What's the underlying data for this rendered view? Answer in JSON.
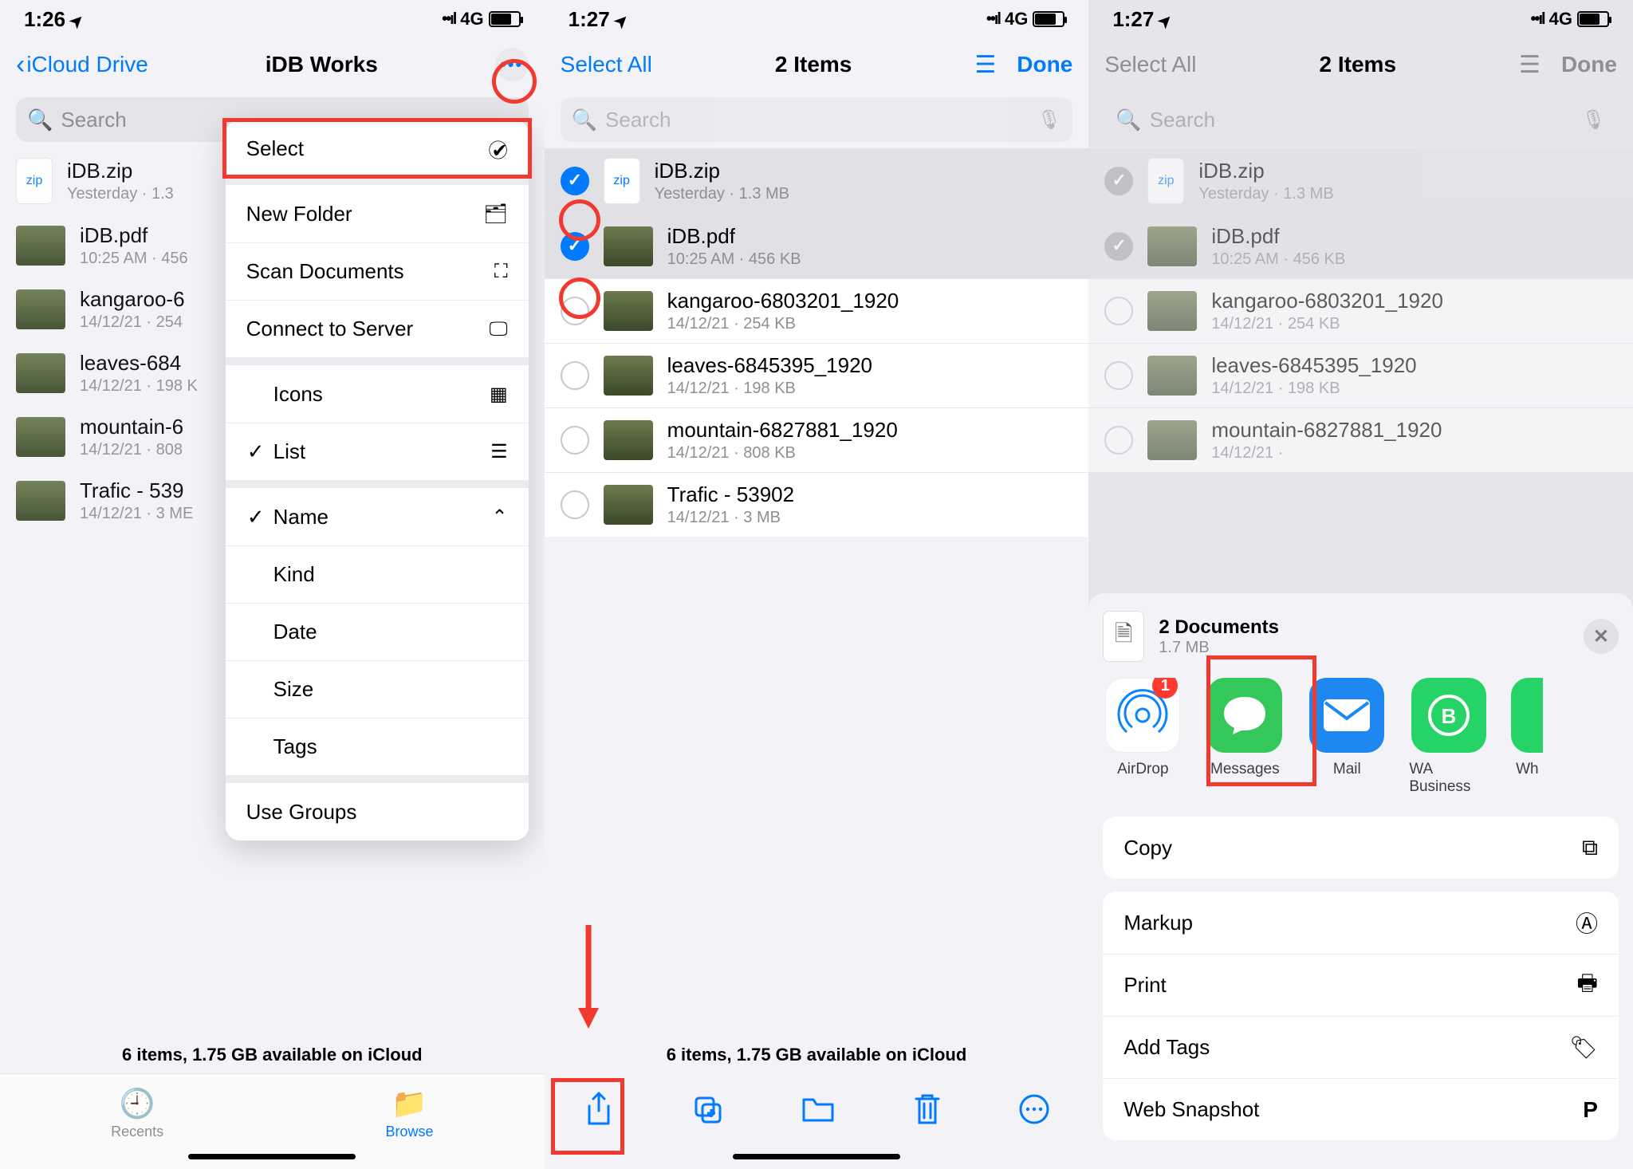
{
  "s1": {
    "time": "1:26",
    "net": "4G",
    "back": "iCloud Drive",
    "title": "iDB Works",
    "search": "Search",
    "menu": {
      "select": "Select",
      "newfolder": "New Folder",
      "scan": "Scan Documents",
      "connect": "Connect to Server",
      "icons": "Icons",
      "list": "List",
      "name": "Name",
      "kind": "Kind",
      "date": "Date",
      "size": "Size",
      "tags": "Tags",
      "groups": "Use Groups"
    },
    "files": [
      {
        "n": "iDB.zip",
        "s": "Yesterday · 1.3",
        "t": "zip"
      },
      {
        "n": "iDB.pdf",
        "s": "10:25 AM · 456",
        "t": "img"
      },
      {
        "n": "kangaroo-6",
        "s": "14/12/21 · 254",
        "t": "img"
      },
      {
        "n": "leaves-684",
        "s": "14/12/21 · 198 K",
        "t": "img"
      },
      {
        "n": "mountain-6",
        "s": "14/12/21 · 808",
        "t": "img"
      },
      {
        "n": "Trafic - 539",
        "s": "14/12/21 · 3 ME",
        "t": "img"
      }
    ],
    "bottom": "6 items, 1.75 GB available on iCloud",
    "tab_recents": "Recents",
    "tab_browse": "Browse"
  },
  "s2": {
    "time": "1:27",
    "net": "4G",
    "select_all": "Select All",
    "title": "2 Items",
    "done": "Done",
    "search": "Search",
    "files": [
      {
        "n": "iDB.zip",
        "s": "Yesterday · 1.3 MB",
        "t": "zip",
        "sel": true
      },
      {
        "n": "iDB.pdf",
        "s": "10:25 AM · 456 KB",
        "t": "img",
        "sel": true
      },
      {
        "n": "kangaroo-6803201_1920",
        "s": "14/12/21 · 254 KB",
        "t": "img",
        "sel": false
      },
      {
        "n": "leaves-6845395_1920",
        "s": "14/12/21 · 198 KB",
        "t": "img",
        "sel": false
      },
      {
        "n": "mountain-6827881_1920",
        "s": "14/12/21 · 808 KB",
        "t": "img",
        "sel": false
      },
      {
        "n": "Trafic - 53902",
        "s": "14/12/21 · 3 MB",
        "t": "img",
        "sel": false
      }
    ],
    "bottom": "6 items, 1.75 GB available on iCloud"
  },
  "s3": {
    "time": "1:27",
    "net": "4G",
    "select_all": "Select All",
    "title": "2 Items",
    "done": "Done",
    "search": "Search",
    "files": [
      {
        "n": "iDB.zip",
        "s": "Yesterday · 1.3 MB",
        "t": "zip",
        "sel": true
      },
      {
        "n": "iDB.pdf",
        "s": "10:25 AM · 456 KB",
        "t": "img",
        "sel": true
      },
      {
        "n": "kangaroo-6803201_1920",
        "s": "14/12/21 · 254 KB",
        "t": "img",
        "sel": false
      },
      {
        "n": "leaves-6845395_1920",
        "s": "14/12/21 · 198 KB",
        "t": "img",
        "sel": false
      },
      {
        "n": "mountain-6827881_1920",
        "s": "14/12/21 ·",
        "t": "img",
        "sel": false
      }
    ],
    "sheet": {
      "title": "2 Documents",
      "sub": "1.7 MB",
      "airdrop_badge": "1",
      "app_airdrop": "AirDrop",
      "app_msg": "Messages",
      "app_mail": "Mail",
      "app_wab": "WA Business",
      "app_wa": "Wh",
      "copy": "Copy",
      "markup": "Markup",
      "print": "Print",
      "addtags": "Add Tags",
      "snapshot": "Web Snapshot"
    }
  }
}
